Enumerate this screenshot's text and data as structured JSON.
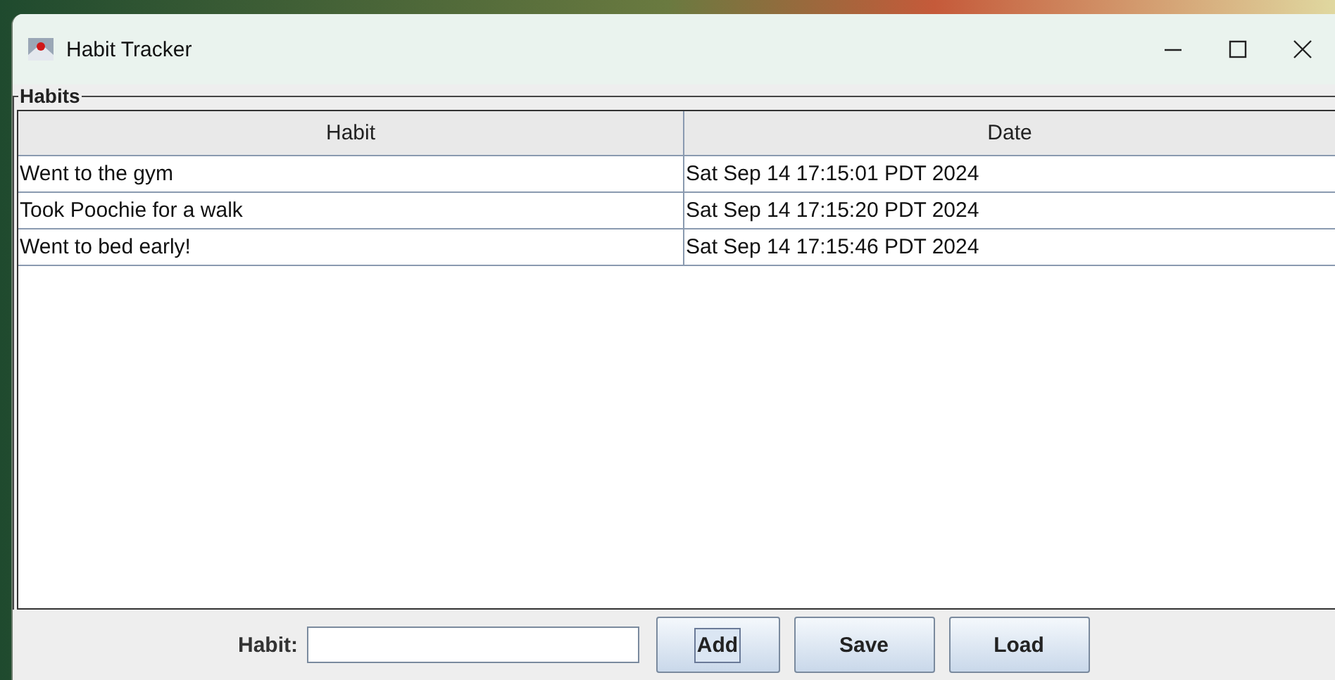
{
  "window": {
    "title": "Habit Tracker"
  },
  "group": {
    "title": "Habits"
  },
  "table": {
    "columns": [
      "Habit",
      "Date"
    ],
    "rows": [
      [
        "Went to the gym",
        "Sat Sep 14 17:15:01 PDT 2024"
      ],
      [
        "Took Poochie for a walk",
        "Sat Sep 14 17:15:20 PDT 2024"
      ],
      [
        "Went to bed early!",
        "Sat Sep 14 17:15:46 PDT 2024"
      ]
    ]
  },
  "form": {
    "label": "Habit:",
    "buttons": [
      {
        "label": "Add",
        "focused": true
      },
      {
        "label": "Save",
        "focused": false
      },
      {
        "label": "Load",
        "focused": false
      }
    ]
  }
}
